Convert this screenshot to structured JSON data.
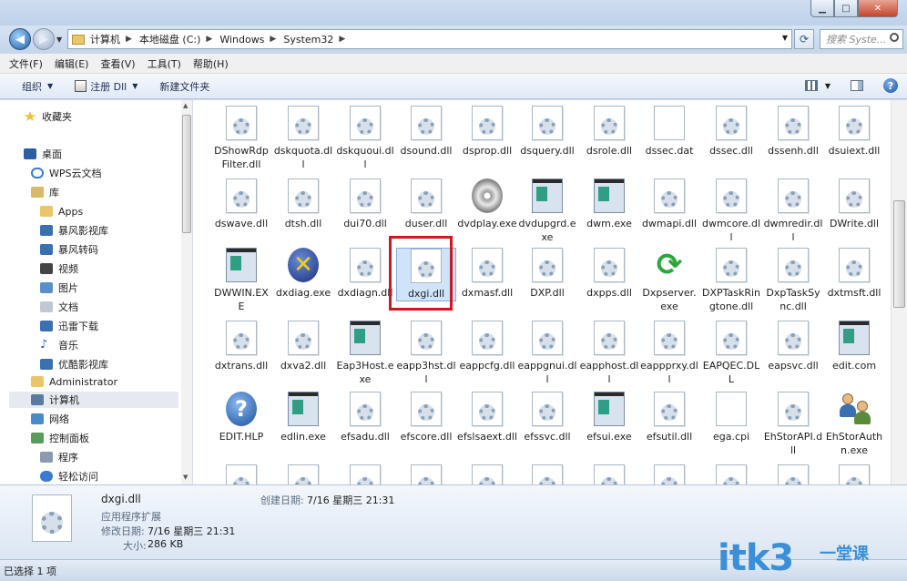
{
  "address": {
    "crumbs": [
      "计算机",
      "本地磁盘 (C:)",
      "Windows",
      "System32"
    ],
    "search_placeholder": "搜索 Syste..."
  },
  "menu": [
    "文件(F)",
    "编辑(E)",
    "查看(V)",
    "工具(T)",
    "帮助(H)"
  ],
  "toolbar": {
    "organize": "组织",
    "register": "注册 Dll",
    "new_folder": "新建文件夹"
  },
  "sidebar": {
    "favorites": "收藏夹",
    "desktop": "桌面",
    "wps": "WPS云文档",
    "library": "库",
    "apps": "Apps",
    "storm_video": "暴风影视库",
    "storm_convert": "暴风转码",
    "video": "视频",
    "pictures": "图片",
    "documents": "文档",
    "xunlei": "迅雷下载",
    "music": "音乐",
    "youku": "优酷影视库",
    "admin": "Administrator",
    "computer": "计算机",
    "network": "网络",
    "control_panel": "控制面板",
    "programs": "程序",
    "ease_access": "轻松访问"
  },
  "files": [
    [
      "DShowRdpFilter.dll",
      "dskquota.dll",
      "dskquoui.dll",
      "dsound.dll",
      "dsprop.dll",
      "dsquery.dll",
      "dsrole.dll",
      "dssec.dat",
      "dssec.dll",
      "dssenh.dll",
      "dsuiext.dll"
    ],
    [
      "dswave.dll",
      "dtsh.dll",
      "dui70.dll",
      "duser.dll",
      "dvdplay.exe",
      "dvdupgrd.exe",
      "dwm.exe",
      "dwmapi.dll",
      "dwmcore.dll",
      "dwmredir.dll",
      "DWrite.dll"
    ],
    [
      "DWWIN.EXE",
      "dxdiag.exe",
      "dxdiagn.dll",
      "dxgi.dll",
      "dxmasf.dll",
      "DXP.dll",
      "dxpps.dll",
      "Dxpserver.exe",
      "DXPTaskRingtone.dll",
      "DxpTaskSync.dll",
      "dxtmsft.dll"
    ],
    [
      "dxtrans.dll",
      "dxva2.dll",
      "Eap3Host.exe",
      "eapp3hst.dll",
      "eappcfg.dll",
      "eappgnui.dll",
      "eapphost.dll",
      "eappprxy.dll",
      "EAPQEC.DLL",
      "eapsvc.dll",
      "edit.com"
    ],
    [
      "EDIT.HLP",
      "edlin.exe",
      "efsadu.dll",
      "efscore.dll",
      "efslsaext.dll",
      "efssvc.dll",
      "efsui.exe",
      "efsutil.dll",
      "ega.cpi",
      "EhStorAPI.dll",
      "EhStorAuthn.exe"
    ]
  ],
  "details": {
    "name": "dxgi.dll",
    "type": "应用程序扩展",
    "modified_label": "修改日期:",
    "modified_value": "7/16 星期三 21:31",
    "size_label": "大小:",
    "size_value": "286 KB",
    "created_label": "创建日期:",
    "created_value": "7/16 星期三 21:31"
  },
  "status": "已选择 1 项",
  "watermark": {
    "brand": "itk3",
    "suffix": "一堂课"
  }
}
